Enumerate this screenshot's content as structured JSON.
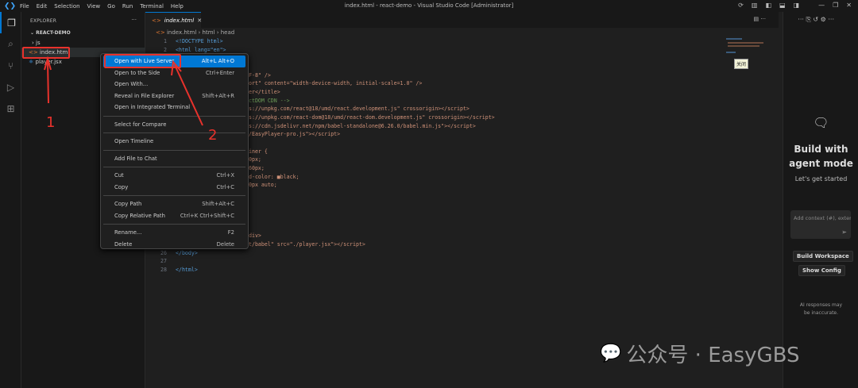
{
  "titlebar": {
    "menu": [
      "File",
      "Edit",
      "Selection",
      "View",
      "Go",
      "Run",
      "Terminal",
      "Help"
    ],
    "title": "index.html - react-demo - Visual Studio Code [Administrator]"
  },
  "explorer": {
    "title": "EXPLORER",
    "project": "REACT-DEMO",
    "items": [
      "js",
      "index.html",
      "player.jsx"
    ]
  },
  "editor": {
    "tab": "index.html",
    "breadcrumb": [
      "index.html",
      "html",
      "head"
    ],
    "lines": [
      {
        "n": "1",
        "t": "<!DOCTYPE html>"
      },
      {
        "n": "2",
        "t": "<html lang=\"en\">"
      },
      {
        "n": "",
        "t": "F-8\" />"
      },
      {
        "n": "",
        "t": "ort\" content=\"width-device-width, initial-scale=1.0\" />"
      },
      {
        "n": "",
        "t": "er</title>"
      },
      {
        "n": "",
        "t": "ctDOM CDN -->"
      },
      {
        "n": "",
        "t": "s://unpkg.com/react@18/umd/react.development.js\" crossorigin></script>"
      },
      {
        "n": "",
        "t": "s://unpkg.com/react-dom@18/umd/react-dom.development.js\" crossorigin></script>"
      },
      {
        "n": "",
        "t": "s://cdn.jsdelivr.net/npm/babel-standalone@6.26.0/babel.min.js\"></script>"
      },
      {
        "n": "",
        "t": "/EasyPlayer-pro.js\"></script>"
      },
      {
        "n": "",
        "t": "iner {"
      },
      {
        "n": "",
        "t": "0px;"
      },
      {
        "n": "",
        "t": "60px;"
      },
      {
        "n": "",
        "t": "d-color: ■black;"
      },
      {
        "n": "",
        "t": "0px auto;"
      },
      {
        "n": "",
        "t": "div>"
      },
      {
        "n": "",
        "t": "t/babel\" src=\"./player.jsx\"></script>"
      },
      {
        "n": "26",
        "t": "</body>"
      },
      {
        "n": "27",
        "t": ""
      },
      {
        "n": "28",
        "t": "</html>"
      }
    ],
    "tooltip": "关闭"
  },
  "context_menu": [
    {
      "label": "Open with Live Server",
      "key": "Alt+L Alt+O",
      "highlighted": true
    },
    {
      "label": "Open to the Side",
      "key": "Ctrl+Enter"
    },
    {
      "label": "Open With...",
      "key": ""
    },
    {
      "label": "Reveal in File Explorer",
      "key": "Shift+Alt+R"
    },
    {
      "label": "Open in Integrated Terminal",
      "key": ""
    },
    {
      "label": "Select for Compare",
      "key": ""
    },
    {
      "label": "Open Timeline",
      "key": ""
    },
    {
      "label": "Add File to Chat",
      "key": ""
    },
    {
      "label": "Cut",
      "key": "Ctrl+X"
    },
    {
      "label": "Copy",
      "key": "Ctrl+C"
    },
    {
      "label": "Copy Path",
      "key": "Shift+Alt+C"
    },
    {
      "label": "Copy Relative Path",
      "key": "Ctrl+K Ctrl+Shift+C"
    },
    {
      "label": "Rename...",
      "key": "F2"
    },
    {
      "label": "Delete",
      "key": "Delete"
    }
  ],
  "chat": {
    "title": "Build with agent mode",
    "subtitle": "Let's get started",
    "input_placeholder": "Add context (#), exter",
    "build_workspace": "Build Workspace",
    "show_config": "Show Config",
    "disclaimer": "AI responses may be inaccurate."
  },
  "annotations": {
    "step1": "1",
    "step2": "2",
    "color": "#e8322c"
  },
  "watermark": "公众号 · EasyGBS",
  "colors": {
    "accent": "#0078d4",
    "background": "#1f1f1f"
  }
}
